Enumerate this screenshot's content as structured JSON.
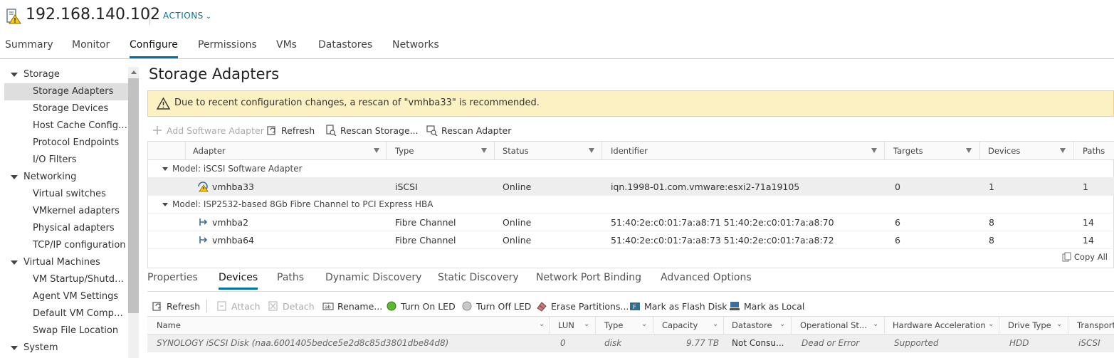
{
  "header": {
    "host": "192.168.140.102",
    "actions_label": "ACTIONS"
  },
  "tabs": [
    {
      "label": "Summary"
    },
    {
      "label": "Monitor"
    },
    {
      "label": "Configure"
    },
    {
      "label": "Permissions"
    },
    {
      "label": "VMs"
    },
    {
      "label": "Datastores"
    },
    {
      "label": "Networks"
    }
  ],
  "sidebar": {
    "groups": [
      {
        "label": "Storage",
        "items": [
          "Storage Adapters",
          "Storage Devices",
          "Host Cache Configur...",
          "Protocol Endpoints",
          "I/O Filters"
        ]
      },
      {
        "label": "Networking",
        "items": [
          "Virtual switches",
          "VMkernel adapters",
          "Physical adapters",
          "TCP/IP configuration"
        ]
      },
      {
        "label": "Virtual Machines",
        "items": [
          "VM Startup/Shutdo...",
          "Agent VM Settings",
          "Default VM Compati...",
          "Swap File Location"
        ]
      },
      {
        "label": "System",
        "items": []
      }
    ]
  },
  "page": {
    "title": "Storage Adapters",
    "banner": "Due to recent configuration changes, a rescan of \"vmhba33\" is recommended."
  },
  "toolbar": {
    "add_software_adapter": "Add Software Adapter",
    "refresh": "Refresh",
    "rescan_storage": "Rescan Storage...",
    "rescan_adapter": "Rescan Adapter"
  },
  "adapters_table": {
    "columns": [
      "Adapter",
      "Type",
      "Status",
      "Identifier",
      "Targets",
      "Devices",
      "Paths"
    ],
    "groups": [
      {
        "label": "Model: iSCSI Software Adapter",
        "rows": [
          {
            "adapter": "vmhba33",
            "type": "iSCSI",
            "status": "Online",
            "identifier": "iqn.1998-01.com.vmware:esxi2-71a19105",
            "targets": "0",
            "devices": "1",
            "paths": "1"
          }
        ]
      },
      {
        "label": "Model: ISP2532-based 8Gb Fibre Channel to PCI Express HBA",
        "rows": [
          {
            "adapter": "vmhba2",
            "type": "Fibre Channel",
            "status": "Online",
            "identifier": "51:40:2e:c0:01:7a:a8:71 51:40:2e:c0:01:7a:a8:70",
            "targets": "6",
            "devices": "8",
            "paths": "14"
          },
          {
            "adapter": "vmhba64",
            "type": "Fibre Channel",
            "status": "Online",
            "identifier": "51:40:2e:c0:01:7a:a8:73 51:40:2e:c0:01:7a:a8:72",
            "targets": "6",
            "devices": "8",
            "paths": "14"
          }
        ]
      }
    ],
    "copy_all": "Copy All"
  },
  "detail_tabs": [
    {
      "label": "Properties"
    },
    {
      "label": "Devices"
    },
    {
      "label": "Paths"
    },
    {
      "label": "Dynamic Discovery"
    },
    {
      "label": "Static Discovery"
    },
    {
      "label": "Network Port Binding"
    },
    {
      "label": "Advanced Options"
    }
  ],
  "devices_toolbar": {
    "refresh": "Refresh",
    "attach": "Attach",
    "detach": "Detach",
    "rename": "Rename...",
    "turn_on_led": "Turn On LED",
    "turn_off_led": "Turn Off LED",
    "erase_partitions": "Erase Partitions...",
    "mark_flash": "Mark as Flash Disk",
    "mark_local": "Mark as Local"
  },
  "devices_table": {
    "columns": [
      "Name",
      "LUN",
      "Type",
      "Capacity",
      "Datastore",
      "Operational St...",
      "Hardware Acceleration",
      "Drive Type",
      "Transport"
    ],
    "rows": [
      {
        "name": "SYNOLOGY iSCSI Disk (naa.6001405bedce5e2d8c85d3801dbe84d8)",
        "lun": "0",
        "type": "disk",
        "capacity": "9.77 TB",
        "datastore": "Not Consu...",
        "operational_state": "Dead or Error",
        "hw_accel": "Supported",
        "drive_type": "HDD",
        "transport": "iSCSI"
      }
    ]
  },
  "colors": {
    "accent": "#0072a3",
    "banner_bg": "#fcf1c3",
    "selected_row": "#dedede"
  }
}
